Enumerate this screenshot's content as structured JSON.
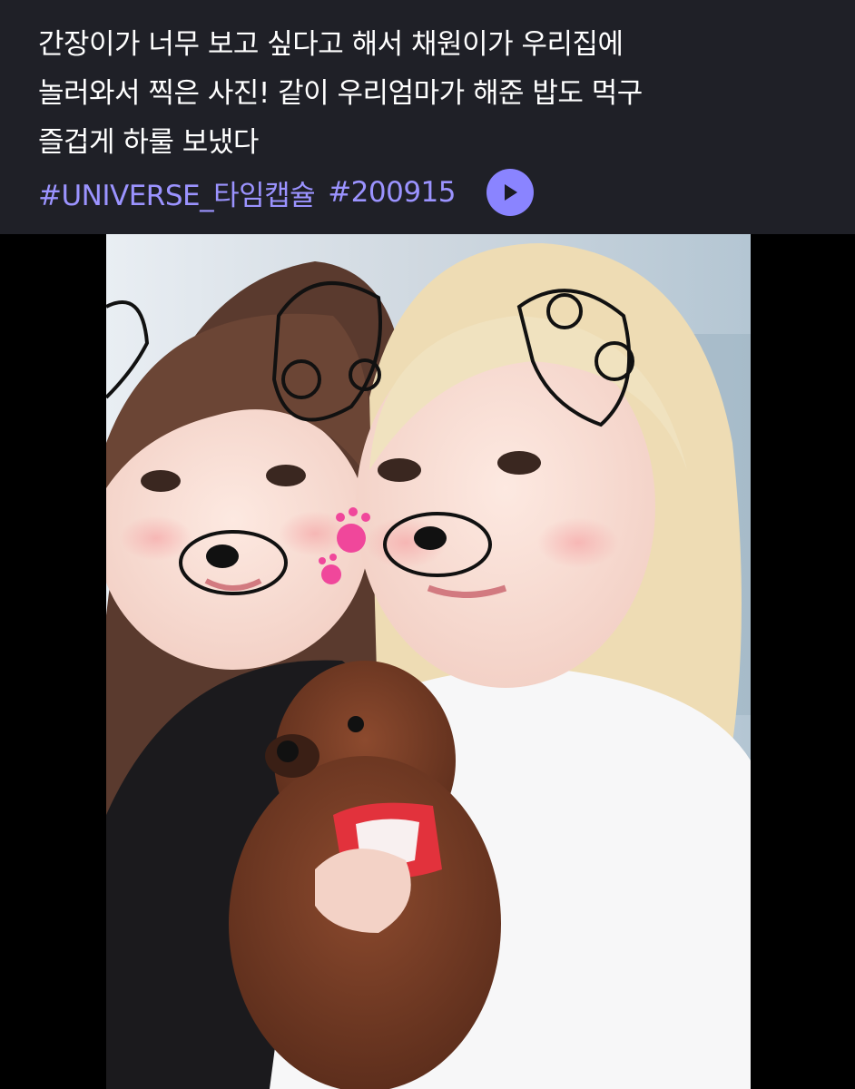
{
  "post": {
    "caption_lines": [
      "간장이가 너무 보고 싶다고 해서 채원이가 우리집에",
      "놀러와서 찍은 사진! 같이 우리엄마가 해준 밥도 먹구",
      "즐겁게 하룰 보냈다"
    ],
    "hashtags": [
      "#UNIVERSE_타임캡슐",
      "#200915"
    ],
    "play_icon": "play-icon"
  },
  "colors": {
    "header_bg": "#1f2027",
    "caption_text": "#ffffff",
    "hashtag": "#9b93ff",
    "play_button": "#8a84ff",
    "media_bg": "#000000"
  }
}
